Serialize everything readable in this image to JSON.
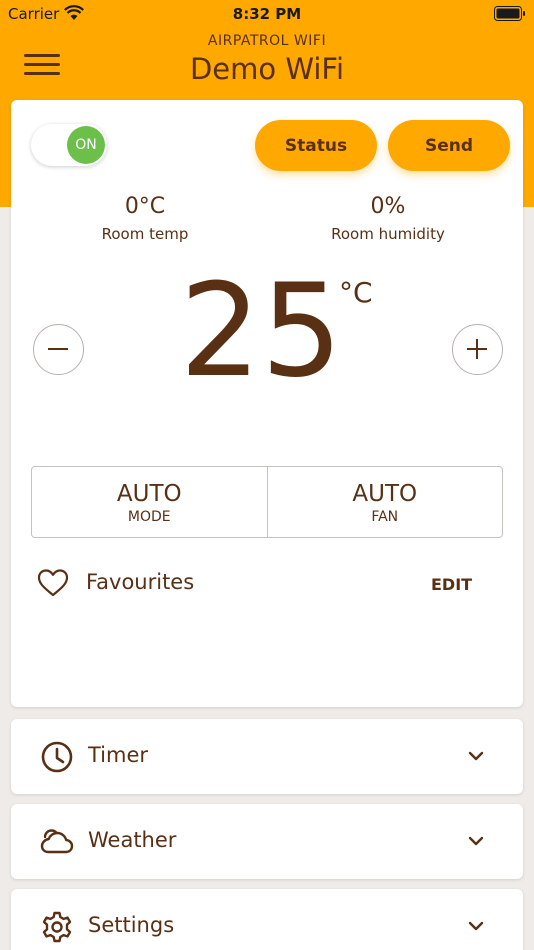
{
  "status_bar": {
    "carrier": "Carrier",
    "time": "8:32 PM"
  },
  "header": {
    "subtitle": "AIRPATROL WIFI",
    "title": "Demo WiFi"
  },
  "colors": {
    "accent": "#ffa800",
    "text": "#5a3015",
    "on_green": "#6cc04a",
    "background": "#efebe8"
  },
  "control": {
    "power_toggle": {
      "label": "ON",
      "state": "on"
    },
    "status_button": "Status",
    "send_button": "Send",
    "room_temp": {
      "value": "0°C",
      "label": "Room temp"
    },
    "room_humidity": {
      "value": "0%",
      "label": "Room humidity"
    },
    "set_temperature": "25",
    "temperature_unit": "°C",
    "mode": {
      "value": "AUTO",
      "label": "MODE"
    },
    "fan": {
      "value": "AUTO",
      "label": "FAN"
    },
    "favourites": {
      "label": "Favourites",
      "edit": "EDIT"
    }
  },
  "sections": [
    {
      "label": "Timer",
      "icon": "clock-icon"
    },
    {
      "label": "Weather",
      "icon": "cloud-icon"
    },
    {
      "label": "Settings",
      "icon": "gear-icon"
    }
  ]
}
